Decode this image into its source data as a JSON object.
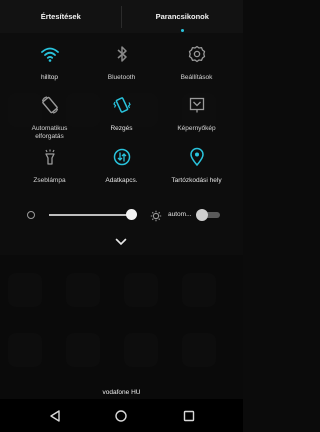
{
  "tabs": {
    "notifications": "Értesítések",
    "shortcuts": "Parancsikonok"
  },
  "tiles": [
    {
      "label": "hilltop",
      "icon": "wifi-icon",
      "active": true
    },
    {
      "label": "Bluetooth",
      "icon": "bluetooth-icon",
      "active": false
    },
    {
      "label": "Beállítások",
      "icon": "settings-icon",
      "active": false
    },
    {
      "label": "Automatikus elforgatás",
      "icon": "auto-rotate-icon",
      "active": false
    },
    {
      "label": "Rezgés",
      "icon": "vibrate-icon",
      "active": true
    },
    {
      "label": "Képernyőkép",
      "icon": "screenshot-icon",
      "active": false
    },
    {
      "label": "Zseblámpa",
      "icon": "flashlight-icon",
      "active": false
    },
    {
      "label": "Adatkapcs.",
      "icon": "mobile-data-icon",
      "active": true
    },
    {
      "label": "Tartózkodási hely",
      "icon": "location-icon",
      "active": true
    }
  ],
  "brightness": {
    "auto_label": "autom...",
    "level": 0.85,
    "auto_enabled": false
  },
  "status": {
    "carrier": "vodafone HU"
  },
  "colors": {
    "accent": "#29c3dc",
    "inactive_icon": "#8a8a8a"
  }
}
